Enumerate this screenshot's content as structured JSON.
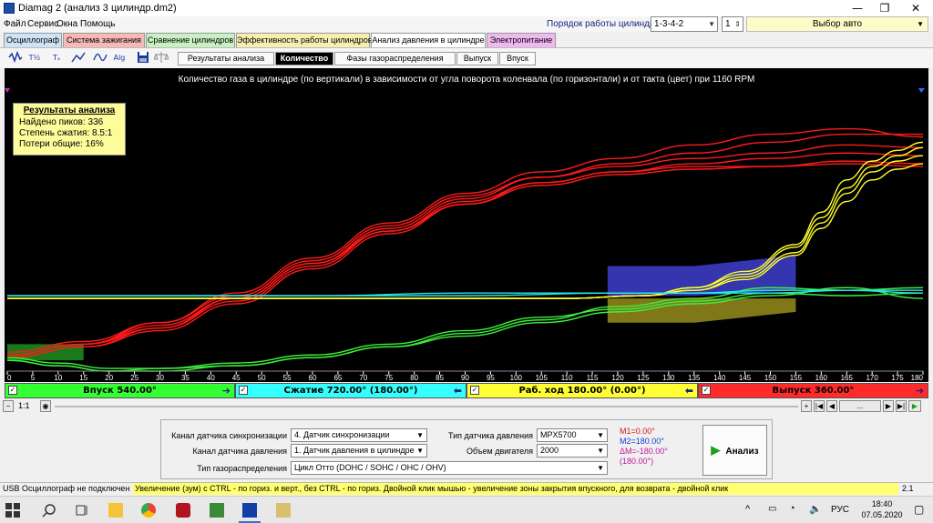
{
  "window": {
    "title": "Diamag 2 (анализ 3 цилиндр.dm2)",
    "minimize": "—",
    "maximize": "❐",
    "close": "✕"
  },
  "menu": [
    "Файл",
    "Сервис",
    "Окна",
    "Помощь"
  ],
  "cylinder_order": {
    "label": "Порядок работы цилиндров",
    "value": "1-3-4-2",
    "cylinder": "1"
  },
  "auto_select": "Выбор авто",
  "main_tabs": [
    {
      "label": "Осциллограф",
      "color": "#cfe3f7"
    },
    {
      "label": "Система зажигания",
      "color": "#f7b8b8"
    },
    {
      "label": "Сравнение цилиндров",
      "color": "#c8f0c0"
    },
    {
      "label": "Эффективность работы цилиндров",
      "color": "#f7efb0"
    },
    {
      "label": "Анализ давления в цилиндре",
      "color": "#ffffff"
    },
    {
      "label": "Электропитание",
      "color": "#f0b8f0"
    }
  ],
  "toolbar": {
    "icons": [
      "waveform-icon",
      "t-half-icon",
      "t-auto-icon",
      "trend-icon",
      "wave-small-icon",
      "algorithm-icon",
      "save-icon",
      "scale-icon"
    ],
    "icon_text": [
      "",
      "T\n1/24",
      "T\nauto",
      "",
      "",
      "Alg\n1/2",
      "",
      ""
    ]
  },
  "sub_tabs": [
    {
      "label": "Результаты анализа",
      "active": false
    },
    {
      "label": "Количество",
      "active": true
    },
    {
      "label": "Фазы газораспределения",
      "active": false
    },
    {
      "label": "Выпуск",
      "active": false
    },
    {
      "label": "Впуск",
      "active": false
    }
  ],
  "chart_data": {
    "type": "line",
    "title": "Количество газа в цилиндре (по вертикали) в зависимости от угла поворота коленвала (по горизонтали) и от такта (цвет) при 1160 RPM",
    "x_ticks": [
      0,
      5,
      10,
      15,
      20,
      25,
      30,
      35,
      40,
      45,
      50,
      55,
      60,
      65,
      70,
      75,
      80,
      85,
      90,
      95,
      100,
      105,
      110,
      115,
      120,
      125,
      130,
      135,
      140,
      145,
      150,
      155,
      160,
      165,
      170,
      175,
      180
    ],
    "xlim": [
      0,
      180
    ],
    "series": [
      {
        "color": "#ff1a1a",
        "x": [
          0,
          15,
          30,
          45,
          60,
          75,
          90,
          105,
          120,
          135,
          150,
          165,
          180
        ],
        "y": [
          0.06,
          0.1,
          0.17,
          0.27,
          0.4,
          0.53,
          0.64,
          0.72,
          0.77,
          0.81,
          0.85,
          0.88,
          0.88
        ]
      },
      {
        "color": "#ff1a1a",
        "x": [
          0,
          15,
          30,
          45,
          60,
          75,
          90,
          105,
          120,
          135,
          150,
          165,
          180
        ],
        "y": [
          0.05,
          0.09,
          0.15,
          0.25,
          0.38,
          0.51,
          0.62,
          0.7,
          0.74,
          0.77,
          0.79,
          0.81,
          0.8
        ]
      },
      {
        "color": "#ff1a1a",
        "x": [
          0,
          15,
          30,
          45,
          60,
          75,
          90,
          105,
          120,
          135,
          150,
          165,
          180
        ],
        "y": [
          0.06,
          0.1,
          0.16,
          0.26,
          0.39,
          0.52,
          0.63,
          0.7,
          0.74,
          0.76,
          0.76,
          0.77,
          0.76
        ]
      },
      {
        "color": "#ff1a1a",
        "x": [
          0,
          15,
          30,
          45,
          60,
          75,
          90,
          105,
          120,
          135,
          150,
          165,
          180
        ],
        "y": [
          0.07,
          0.11,
          0.18,
          0.28,
          0.41,
          0.54,
          0.65,
          0.72,
          0.76,
          0.79,
          0.81,
          0.84,
          0.83
        ]
      },
      {
        "color": "#ff1a1a",
        "x": [
          0,
          15,
          30,
          45,
          60,
          75,
          90,
          105,
          120,
          135,
          150,
          165,
          180
        ],
        "y": [
          0.05,
          0.09,
          0.16,
          0.27,
          0.4,
          0.52,
          0.62,
          0.69,
          0.73,
          0.75,
          0.76,
          0.78,
          0.77
        ]
      },
      {
        "color": "#ff1a1a",
        "x": [
          0,
          15,
          30,
          45,
          60,
          75,
          90,
          105,
          120,
          135,
          150,
          165,
          180
        ],
        "y": [
          0.06,
          0.1,
          0.18,
          0.29,
          0.42,
          0.55,
          0.66,
          0.74,
          0.79,
          0.84,
          0.88,
          0.9,
          0.87
        ]
      },
      {
        "color": "#ffff2a",
        "x": [
          0,
          30,
          60,
          90,
          110,
          125,
          135,
          145,
          155,
          160,
          165,
          170,
          175,
          180
        ],
        "y": [
          0.27,
          0.27,
          0.27,
          0.27,
          0.27,
          0.28,
          0.31,
          0.37,
          0.47,
          0.59,
          0.71,
          0.78,
          0.82,
          0.85
        ]
      },
      {
        "color": "#ffff2a",
        "x": [
          0,
          30,
          60,
          90,
          110,
          125,
          135,
          145,
          155,
          160,
          165,
          170,
          175,
          180
        ],
        "y": [
          0.27,
          0.27,
          0.27,
          0.27,
          0.27,
          0.28,
          0.3,
          0.35,
          0.44,
          0.55,
          0.66,
          0.74,
          0.78,
          0.8
        ]
      },
      {
        "color": "#ffff2a",
        "x": [
          0,
          30,
          60,
          90,
          110,
          125,
          135,
          145,
          155,
          160,
          165,
          170,
          175,
          180
        ],
        "y": [
          0.27,
          0.27,
          0.27,
          0.27,
          0.27,
          0.28,
          0.31,
          0.36,
          0.46,
          0.57,
          0.68,
          0.76,
          0.8,
          0.83
        ]
      },
      {
        "color": "#ffff2a",
        "x": [
          0,
          30,
          60,
          90,
          110,
          125,
          135,
          145,
          155,
          160,
          165,
          170,
          175,
          180
        ],
        "y": [
          0.27,
          0.27,
          0.27,
          0.27,
          0.27,
          0.28,
          0.3,
          0.34,
          0.43,
          0.53,
          0.63,
          0.71,
          0.75,
          0.77
        ]
      },
      {
        "color": "#3cf03c",
        "x": [
          0,
          10,
          20,
          30,
          45,
          60,
          75,
          90,
          105,
          120,
          135,
          150,
          165,
          180
        ],
        "y": [
          0.04,
          0.02,
          0.0,
          0.0,
          0.02,
          0.05,
          0.09,
          0.14,
          0.19,
          0.24,
          0.27,
          0.31,
          0.3,
          0.31
        ]
      },
      {
        "color": "#3cf03c",
        "x": [
          0,
          10,
          20,
          30,
          45,
          60,
          75,
          90,
          105,
          120,
          135,
          150,
          165,
          180
        ],
        "y": [
          0.05,
          0.03,
          0.01,
          0.01,
          0.03,
          0.06,
          0.1,
          0.15,
          0.2,
          0.23,
          0.26,
          0.29,
          0.28,
          0.29
        ]
      },
      {
        "color": "#3cf03c",
        "x": [
          0,
          10,
          20,
          30,
          45,
          60,
          75,
          90,
          105,
          120,
          135,
          150,
          165,
          180
        ],
        "y": [
          0.04,
          0.02,
          0.0,
          0.01,
          0.02,
          0.05,
          0.09,
          0.13,
          0.18,
          0.22,
          0.25,
          0.28,
          0.31,
          0.27
        ]
      },
      {
        "color": "#2ae6e6",
        "x": [
          0,
          30,
          60,
          90,
          120,
          135,
          150,
          165,
          180
        ],
        "y": [
          0.28,
          0.28,
          0.28,
          0.29,
          0.29,
          0.29,
          0.3,
          0.3,
          0.3
        ]
      },
      {
        "color": "#2ae6e6",
        "x": [
          0,
          30,
          60,
          90,
          120,
          135,
          150,
          165,
          180
        ],
        "y": [
          0.28,
          0.28,
          0.28,
          0.28,
          0.29,
          0.29,
          0.29,
          0.3,
          0.29
        ]
      }
    ],
    "results": {
      "title": "Результаты анализа",
      "lines": [
        "Найдено пиков: 336",
        "Степень сжатия: 8.5:1",
        "Потери общие: 16%"
      ]
    }
  },
  "phases": [
    {
      "label": "Впуск 540.00°",
      "color": "#33ff33",
      "arrow": "➔"
    },
    {
      "label": "Сжатие 720.00° (180.00°)",
      "color": "#33ffff",
      "arrow": "⬅"
    },
    {
      "label": "Раб. ход 180.00° (0.00°)",
      "color": "#ffff33",
      "arrow": "⬅"
    },
    {
      "label": "Выпуск 360.00°",
      "color": "#ff2a2a",
      "arrow": "➔"
    }
  ],
  "nav": {
    "zoom": "1:1",
    "ellipsis": "..."
  },
  "panel": {
    "sync_label": "Канал датчика синхронизации",
    "sync_value": "4.  Датчик синхронизации",
    "pressure_ch_label": "Канал датчика давления",
    "pressure_ch_value": "1.  Датчик давления в цилиндре",
    "gas_label": "Тип газораспределения",
    "gas_value": "Цикл Отто (DOHC / SOHC / OHC / OHV)",
    "sensor_type_label": "Тип датчика давления",
    "sensor_type_value": "MPX5700",
    "engine_vol_label": "Объем двигателя",
    "engine_vol_value": "2000",
    "m1": "M1=0.00°",
    "m2": "M2=180.00°",
    "dm": "ΔM=-180.00° (180.00°)",
    "analyze": "Анализ"
  },
  "status": {
    "usb": "USB Осциллограф не подключен",
    "hint": "Увеличение (зум) с CTRL - по гориз. и верт., без CTRL - по гориз.  Двойной клик мышью - увеличение зоны закрытия впускного, для возврата - двойной клик",
    "version": "2.1"
  },
  "taskbar": {
    "lang": "РУС",
    "time": "18:40",
    "date": "07.05.2020"
  }
}
